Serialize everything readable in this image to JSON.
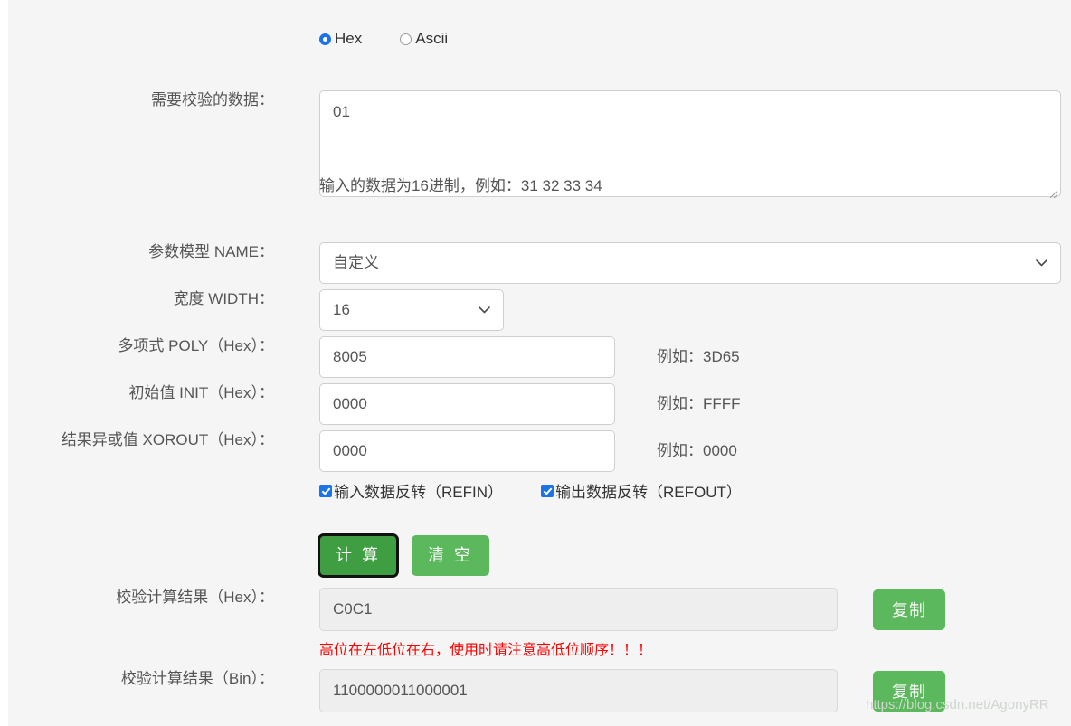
{
  "encoding": {
    "options": [
      {
        "label": "Hex",
        "value": "hex",
        "checked": true
      },
      {
        "label": "Ascii",
        "value": "ascii",
        "checked": false
      }
    ]
  },
  "form": {
    "data_label": "需要校验的数据：",
    "data_value": "01",
    "data_hint": "输入的数据为16进制，例如：31 32 33 34",
    "name_label": "参数模型 NAME：",
    "name_value": "自定义",
    "width_label": "宽度 WIDTH：",
    "width_value": "16",
    "poly_label": "多项式 POLY（Hex）：",
    "poly_value": "8005",
    "poly_example": "例如：3D65",
    "init_label": "初始值 INIT（Hex）：",
    "init_value": "0000",
    "init_example": "例如：FFFF",
    "xorout_label": "结果异或值 XOROUT（Hex）：",
    "xorout_value": "0000",
    "xorout_example": "例如：0000",
    "refin_label": "输入数据反转（REFIN）",
    "refin_checked": true,
    "refout_label": "输出数据反转（REFOUT）",
    "refout_checked": true
  },
  "buttons": {
    "calculate": "计 算",
    "clear": "清 空",
    "copy_hex": "复制",
    "copy_bin": "复制"
  },
  "results": {
    "hex_label": "校验计算结果（Hex）：",
    "hex_value": "C0C1",
    "warning": "高位在左低位在右，使用时请注意高低位顺序！！！",
    "bin_label": "校验计算结果（Bin）：",
    "bin_value": "1100000011000001"
  },
  "watermark": "https://blog.csdn.net/AgonyRR",
  "colors": {
    "page_bg": "#f5f5f5",
    "accent_blue": "#1a73e8",
    "button_green": "#5cb85c",
    "button_green_active": "#3e9e41",
    "warning_red": "#ff0000",
    "label_text": "#555555",
    "field_border": "#cfcfcf",
    "readonly_bg": "#eeeeee"
  }
}
